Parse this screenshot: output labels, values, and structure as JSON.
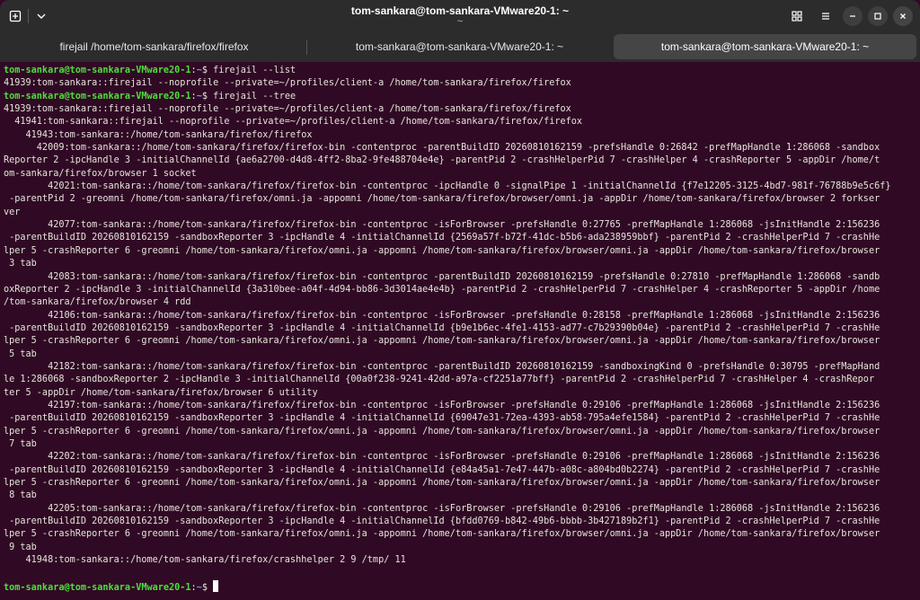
{
  "window": {
    "title": "tom-sankara@tom-sankara-VMware20-1: ~",
    "subtitle": "~"
  },
  "tabs": [
    {
      "label": "firejail /home/tom-sankara/firefox/firefox",
      "active": false
    },
    {
      "label": "tom-sankara@tom-sankara-VMware20-1: ~",
      "active": false
    },
    {
      "label": "tom-sankara@tom-sankara-VMware20-1: ~",
      "active": true
    }
  ],
  "icons": {
    "new_tab": "new-tab-icon",
    "tab_menu": "chevron-down-icon",
    "tab_overview": "grid-icon",
    "menu": "hamburger-menu-icon",
    "minimize": "minimize-icon",
    "maximize": "maximize-icon",
    "close": "close-icon"
  },
  "colors": {
    "terminal_bg": "#300a24",
    "prompt_user": "#4ede3c",
    "prompt_path": "#6aa2ff",
    "text": "#e6e3dc"
  },
  "terminal": {
    "prompt_user": "tom-sankara@tom-sankara-VMware20-1",
    "prompt_sep": ":",
    "prompt_path": "~",
    "prompt_end": "$ ",
    "lines": [
      {
        "type": "prompt",
        "cmd": "firejail --list"
      },
      {
        "type": "out",
        "text": "41939:tom-sankara::firejail --noprofile --private=~/profiles/client-a /home/tom-sankara/firefox/firefox"
      },
      {
        "type": "prompt",
        "cmd": "firejail --tree"
      },
      {
        "type": "out",
        "text": "41939:tom-sankara::firejail --noprofile --private=~/profiles/client-a /home/tom-sankara/firefox/firefox"
      },
      {
        "type": "out",
        "text": "  41941:tom-sankara::firejail --noprofile --private=~/profiles/client-a /home/tom-sankara/firefox/firefox"
      },
      {
        "type": "out",
        "text": "    41943:tom-sankara::/home/tom-sankara/firefox/firefox"
      },
      {
        "type": "out",
        "text": "      42009:tom-sankara::/home/tom-sankara/firefox/firefox-bin -contentproc -parentBuildID 20260810162159 -prefsHandle 0:26842 -prefMapHandle 1:286068 -sandbox"
      },
      {
        "type": "out",
        "text": "Reporter 2 -ipcHandle 3 -initialChannelId {ae6a2700-d4d8-4ff2-8ba2-9fe488704e4e} -parentPid 2 -crashHelperPid 7 -crashHelper 4 -crashReporter 5 -appDir /home/t"
      },
      {
        "type": "out",
        "text": "om-sankara/firefox/browser 1 socket"
      },
      {
        "type": "out",
        "text": "        42021:tom-sankara::/home/tom-sankara/firefox/firefox-bin -contentproc -ipcHandle 0 -signalPipe 1 -initialChannelId {f7e12205-3125-4bd7-981f-76788b9e5c6f}"
      },
      {
        "type": "out",
        "text": " -parentPid 2 -greomni /home/tom-sankara/firefox/omni.ja -appomni /home/tom-sankara/firefox/browser/omni.ja -appDir /home/tom-sankara/firefox/browser 2 forkser"
      },
      {
        "type": "out",
        "text": "ver"
      },
      {
        "type": "out",
        "text": "        42077:tom-sankara::/home/tom-sankara/firefox/firefox-bin -contentproc -isForBrowser -prefsHandle 0:27765 -prefMapHandle 1:286068 -jsInitHandle 2:156236"
      },
      {
        "type": "out",
        "text": " -parentBuildID 20260810162159 -sandboxReporter 3 -ipcHandle 4 -initialChannelId {2569a57f-b72f-41dc-b5b6-ada238959bbf} -parentPid 2 -crashHelperPid 7 -crashHe"
      },
      {
        "type": "out",
        "text": "lper 5 -crashReporter 6 -greomni /home/tom-sankara/firefox/omni.ja -appomni /home/tom-sankara/firefox/browser/omni.ja -appDir /home/tom-sankara/firefox/browser"
      },
      {
        "type": "out",
        "text": " 3 tab"
      },
      {
        "type": "out",
        "text": "        42083:tom-sankara::/home/tom-sankara/firefox/firefox-bin -contentproc -parentBuildID 20260810162159 -prefsHandle 0:27810 -prefMapHandle 1:286068 -sandb"
      },
      {
        "type": "out",
        "text": "oxReporter 2 -ipcHandle 3 -initialChannelId {3a310bee-a04f-4d94-bb86-3d3014ae4e4b} -parentPid 2 -crashHelperPid 7 -crashHelper 4 -crashReporter 5 -appDir /home"
      },
      {
        "type": "out",
        "text": "/tom-sankara/firefox/browser 4 rdd"
      },
      {
        "type": "out",
        "text": "        42106:tom-sankara::/home/tom-sankara/firefox/firefox-bin -contentproc -isForBrowser -prefsHandle 0:28158 -prefMapHandle 1:286068 -jsInitHandle 2:156236"
      },
      {
        "type": "out",
        "text": " -parentBuildID 20260810162159 -sandboxReporter 3 -ipcHandle 4 -initialChannelId {b9e1b6ec-4fe1-4153-ad77-c7b29390b04e} -parentPid 2 -crashHelperPid 7 -crashHe"
      },
      {
        "type": "out",
        "text": "lper 5 -crashReporter 6 -greomni /home/tom-sankara/firefox/omni.ja -appomni /home/tom-sankara/firefox/browser/omni.ja -appDir /home/tom-sankara/firefox/browser"
      },
      {
        "type": "out",
        "text": " 5 tab"
      },
      {
        "type": "out",
        "text": "        42182:tom-sankara::/home/tom-sankara/firefox/firefox-bin -contentproc -parentBuildID 20260810162159 -sandboxingKind 0 -prefsHandle 0:30795 -prefMapHand"
      },
      {
        "type": "out",
        "text": "le 1:286068 -sandboxReporter 2 -ipcHandle 3 -initialChannelId {00a0f238-9241-42dd-a97a-cf2251a77bff} -parentPid 2 -crashHelperPid 7 -crashHelper 4 -crashRepor"
      },
      {
        "type": "out",
        "text": "ter 5 -appDir /home/tom-sankara/firefox/browser 6 utility"
      },
      {
        "type": "out",
        "text": "        42197:tom-sankara::/home/tom-sankara/firefox/firefox-bin -contentproc -isForBrowser -prefsHandle 0:29106 -prefMapHandle 1:286068 -jsInitHandle 2:156236"
      },
      {
        "type": "out",
        "text": " -parentBuildID 20260810162159 -sandboxReporter 3 -ipcHandle 4 -initialChannelId {69047e31-72ea-4393-ab58-795a4efe1584} -parentPid 2 -crashHelperPid 7 -crashHe"
      },
      {
        "type": "out",
        "text": "lper 5 -crashReporter 6 -greomni /home/tom-sankara/firefox/omni.ja -appomni /home/tom-sankara/firefox/browser/omni.ja -appDir /home/tom-sankara/firefox/browser"
      },
      {
        "type": "out",
        "text": " 7 tab"
      },
      {
        "type": "out",
        "text": "        42202:tom-sankara::/home/tom-sankara/firefox/firefox-bin -contentproc -isForBrowser -prefsHandle 0:29106 -prefMapHandle 1:286068 -jsInitHandle 2:156236"
      },
      {
        "type": "out",
        "text": " -parentBuildID 20260810162159 -sandboxReporter 3 -ipcHandle 4 -initialChannelId {e84a45a1-7e47-447b-a08c-a804bd0b2274} -parentPid 2 -crashHelperPid 7 -crashHe"
      },
      {
        "type": "out",
        "text": "lper 5 -crashReporter 6 -greomni /home/tom-sankara/firefox/omni.ja -appomni /home/tom-sankara/firefox/browser/omni.ja -appDir /home/tom-sankara/firefox/browser"
      },
      {
        "type": "out",
        "text": " 8 tab"
      },
      {
        "type": "out",
        "text": "        42205:tom-sankara::/home/tom-sankara/firefox/firefox-bin -contentproc -isForBrowser -prefsHandle 0:29106 -prefMapHandle 1:286068 -jsInitHandle 2:156236"
      },
      {
        "type": "out",
        "text": " -parentBuildID 20260810162159 -sandboxReporter 3 -ipcHandle 4 -initialChannelId {bfdd0769-b842-49b6-bbbb-3b427189b2f1} -parentPid 2 -crashHelperPid 7 -crashHe"
      },
      {
        "type": "out",
        "text": "lper 5 -crashReporter 6 -greomni /home/tom-sankara/firefox/omni.ja -appomni /home/tom-sankara/firefox/browser/omni.ja -appDir /home/tom-sankara/firefox/browser"
      },
      {
        "type": "out",
        "text": " 9 tab"
      },
      {
        "type": "out",
        "text": "    41948:tom-sankara::/home/tom-sankara/firefox/crashhelper 2 9 /tmp/ 11"
      },
      {
        "type": "out",
        "text": ""
      },
      {
        "type": "prompt",
        "cmd": "",
        "cursor": true
      }
    ]
  }
}
